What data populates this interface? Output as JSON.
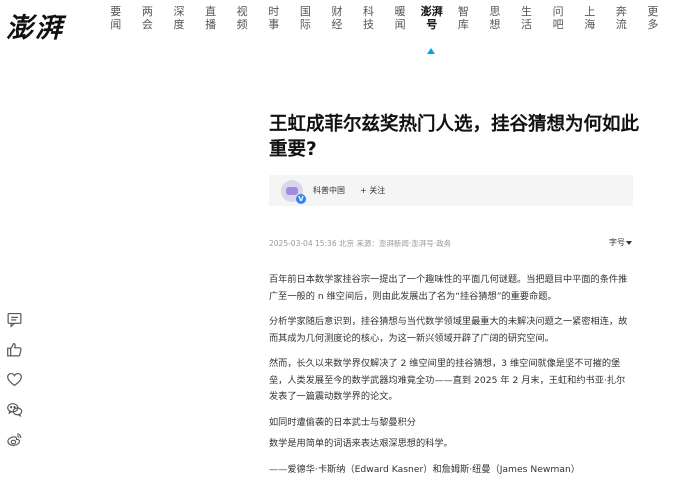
{
  "site": {
    "logo_text": "澎湃"
  },
  "nav": {
    "items": [
      {
        "top": "要",
        "bottom": "闻"
      },
      {
        "top": "两",
        "bottom": "会"
      },
      {
        "top": "深",
        "bottom": "度"
      },
      {
        "top": "直",
        "bottom": "播"
      },
      {
        "top": "视",
        "bottom": "频"
      },
      {
        "top": "时",
        "bottom": "事"
      },
      {
        "top": "国",
        "bottom": "际"
      },
      {
        "top": "财",
        "bottom": "经"
      },
      {
        "top": "科",
        "bottom": "技"
      },
      {
        "top": "暖",
        "bottom": "闻"
      },
      {
        "top": "澎湃",
        "bottom": "号"
      },
      {
        "top": "智",
        "bottom": "库"
      },
      {
        "top": "思",
        "bottom": "想"
      },
      {
        "top": "生",
        "bottom": "活"
      },
      {
        "top": "问",
        "bottom": "吧"
      },
      {
        "top": "上",
        "bottom": "海"
      },
      {
        "top": "奔",
        "bottom": "流"
      },
      {
        "top": "更",
        "bottom": "多"
      }
    ],
    "active_index": 10
  },
  "article": {
    "title": "王虹成菲尔兹奖热门人选，挂谷猜想为何如此重要?",
    "author": {
      "name": "科普中国",
      "follow_label": "+ 关注"
    },
    "meta": "2025-03-04 15:36 北京  来源：澎湃新闻·澎湃号·政务",
    "font_size_label": "字号",
    "paragraphs": [
      "百年前日本数学家挂谷宗一提出了一个趣味性的平面几何谜题。当把题目中平面的条件推广至一般的 n 维空间后，则由此发展出了名为“挂谷猜想”的重要命题。",
      "分析学家随后意识到，挂谷猜想与当代数学领域里最重大的未解决问题之一紧密相连，故而其成为几何测度论的核心，为这一新兴领域开辟了广阔的研究空间。",
      "然而，长久以来数学界仅解决了 2 维空间里的挂谷猜想，3 维空间就像是坚不可摧的堡垒，人类发展至今的数学武器均难竟全功——直到 2025 年 2 月末，王虹和约书亚·扎尔发表了一篇震动数学界的论文。",
      "如同时遭偷袭的日本武士与黎曼积分",
      "数学是用简单的词语来表达艰深思想的科学。",
      "——爱德华·卡斯纳（Edward Kasner）和詹姆斯·纽曼（James Newman）"
    ]
  },
  "side_actions": [
    {
      "icon": "comment-icon"
    },
    {
      "icon": "like-icon"
    },
    {
      "icon": "favorite-heart-icon"
    },
    {
      "icon": "wechat-icon"
    },
    {
      "icon": "weibo-icon"
    }
  ],
  "colors": {
    "accent": "#00a5eb",
    "verified": "#2f86f6"
  }
}
